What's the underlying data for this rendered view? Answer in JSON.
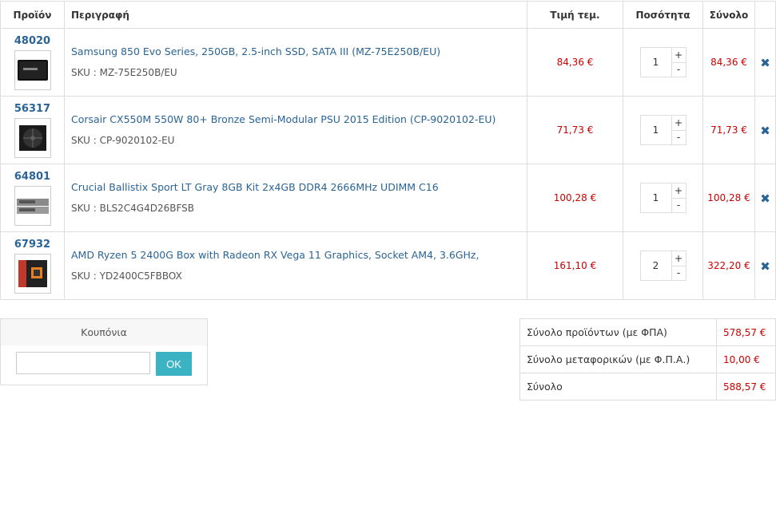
{
  "header": {
    "product": "Προϊόν",
    "description": "Περιγραφή",
    "unit_price": "Τιμή τεμ.",
    "quantity": "Ποσότητα",
    "total": "Σύνολο"
  },
  "items": [
    {
      "id": "48020",
      "name": "Samsung 850 Evo Series, 250GB, 2.5-inch SSD, SATA III (MZ-75E250B/EU)",
      "sku": "SKU : MZ-75E250B/EU",
      "price": "84,36 €",
      "qty": "1",
      "total": "84,36 €",
      "thumb_icon": "ssd-image"
    },
    {
      "id": "56317",
      "name": "Corsair CX550M 550W 80+ Bronze Semi-Modular PSU 2015 Edition (CP-9020102-EU)",
      "sku": "SKU : CP-9020102-EU",
      "price": "71,73 €",
      "qty": "1",
      "total": "71,73 €",
      "thumb_icon": "psu-image"
    },
    {
      "id": "64801",
      "name": "Crucial Ballistix Sport LT Gray 8GB Kit 2x4GB DDR4 2666MHz UDIMM C16",
      "sku": "SKU : BLS2C4G4D26BFSB",
      "price": "100,28 €",
      "qty": "1",
      "total": "100,28 €",
      "thumb_icon": "ram-image"
    },
    {
      "id": "67932",
      "name": "AMD Ryzen 5 2400G Box with Radeon RX Vega 11 Graphics, Socket AM4, 3.6GHz,",
      "sku": "SKU : YD2400C5FBBOX",
      "price": "161,10 €",
      "qty": "2",
      "total": "322,20 €",
      "thumb_icon": "cpu-box-image"
    }
  ],
  "qty_plus": "+",
  "qty_minus": "-",
  "delete_glyph": "✖",
  "coupon": {
    "title": "Κουπόνια",
    "input_value": "",
    "ok_label": "OK"
  },
  "totals": [
    {
      "label": "Σύνολο προϊόντων (με ΦΠΑ)",
      "value": "578,57 €"
    },
    {
      "label": "Σύνολο μεταφορικών (με Φ.Π.Α.)",
      "value": "10,00 €"
    },
    {
      "label": "Σύνολο",
      "value": "588,57 €"
    }
  ],
  "colors": {
    "link": "#2a6496",
    "price": "#cc0000",
    "ok_button": "#3bb3c3",
    "border": "#dddddd"
  }
}
